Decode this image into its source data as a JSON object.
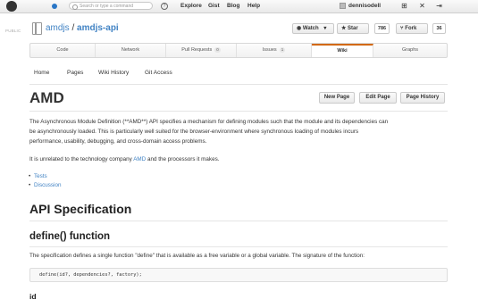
{
  "header": {
    "search_placeholder": "Search or type a command",
    "search_help": "?",
    "nav": [
      "Explore",
      "Gist",
      "Blog",
      "Help"
    ],
    "username": "dennisodell"
  },
  "repo": {
    "visibility": "PUBLIC",
    "owner": "amdjs",
    "separator": " / ",
    "name": "amdjs-api",
    "watch_label": "Watch",
    "watch_caret": "▾",
    "star_label": "Star",
    "star_count": "786",
    "fork_label": "Fork",
    "fork_count": "36"
  },
  "tabs": [
    {
      "label": "Code"
    },
    {
      "label": "Network"
    },
    {
      "label": "Pull Requests",
      "count": "0"
    },
    {
      "label": "Issues",
      "count": "1"
    },
    {
      "label": "Wiki"
    },
    {
      "label": "Graphs"
    }
  ],
  "wiki_nav": [
    "Home",
    "Pages",
    "Wiki History",
    "Git Access"
  ],
  "page": {
    "title": "AMD",
    "buttons": [
      "New Page",
      "Edit Page",
      "Page History"
    ],
    "intro_line1": "The Asynchronous Module Definition (**AMD**) API specifies a mechanism for defining modules such that the module and its dependencies can",
    "intro_line2": "be asynchronously loaded. This is particularly well suited for the browser-environment where synchronous loading of modules incurs",
    "intro_line3": "performance, usability, debugging, and cross-domain access problems.",
    "unrelated_before": "It is unrelated to the technology company ",
    "unrelated_link": "AMD",
    "unrelated_after": " and the processors it makes.",
    "bullets": [
      "Tests",
      "Discussion"
    ],
    "h1": "API Specification",
    "h2": "define() function",
    "spec_text": "The specification defines a single function \"define\" that is available as a free variable or a global variable. The signature of the function:",
    "code": "define(id?, dependencies?, factory);",
    "h3": "id"
  },
  "colors": {
    "link": "#4183c4",
    "selected_tab_accent": "#d26911"
  }
}
